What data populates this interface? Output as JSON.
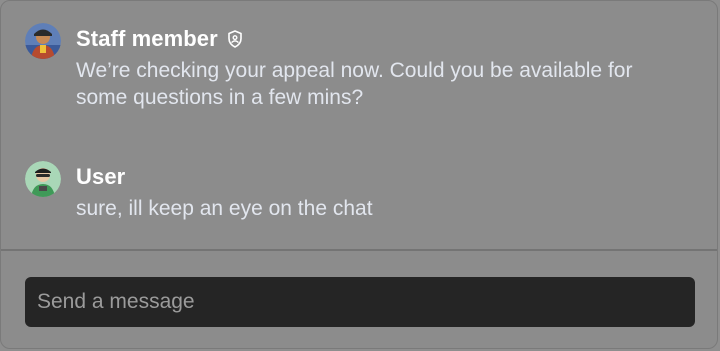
{
  "messages": [
    {
      "author": "Staff member",
      "badge_icon": "shield-badge-icon",
      "avatar_icon": "staff-avatar",
      "text": "We’re checking your appeal now. Could you be available for some questions in a few mins?"
    },
    {
      "author": "User",
      "avatar_icon": "user-avatar",
      "text": "sure, ill keep an eye on the chat"
    }
  ],
  "composer": {
    "placeholder": "Send a message",
    "value": ""
  },
  "colors": {
    "panel_background": "#8c8c8c",
    "input_background": "#252525",
    "author_text": "#ffffff",
    "message_text": "#e2e6ee",
    "placeholder_text": "#9b9b9b"
  }
}
